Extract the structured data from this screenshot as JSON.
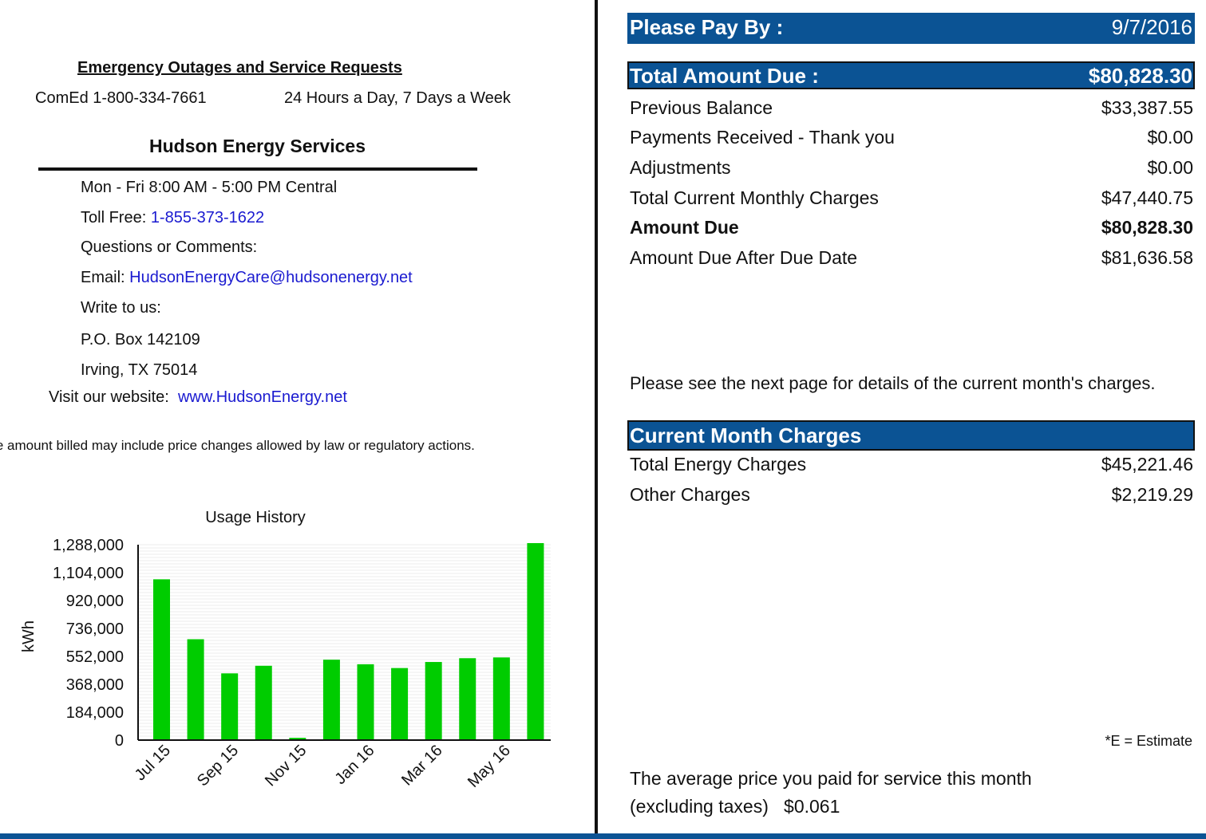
{
  "emergency": {
    "title": "Emergency Outages and Service Requests",
    "utility_phone": "ComEd  1-800-334-7661",
    "hours": "24 Hours a Day, 7 Days a Week"
  },
  "hudson": {
    "title": "Hudson Energy Services",
    "hours": "Mon - Fri 8:00 AM - 5:00 PM Central",
    "toll_free_label": "Toll Free:",
    "toll_free_number": "1-855-373-1622",
    "questions": "Questions or Comments:",
    "email_label": "Email:",
    "email": "HudsonEnergyCare@hudsonenergy.net",
    "write_label": "Write to us:",
    "po_box": "P.O. Box 142109",
    "city": "Irving, TX 75014",
    "website_label": "Visit our website:",
    "website": "www.HudsonEnergy.net"
  },
  "disclaimer": "The amount billed may include price changes allowed by law or regulatory actions.",
  "chart_data": {
    "type": "bar",
    "title": "Usage History",
    "ylabel": "kWh",
    "xlabel": "",
    "ylim": [
      0,
      1288000
    ],
    "yticks": [
      "0",
      "184,000",
      "368,000",
      "552,000",
      "736,000",
      "920,000",
      "1,104,000",
      "1,288,000"
    ],
    "ytick_values": [
      0,
      184000,
      368000,
      552000,
      736000,
      920000,
      1104000,
      1288000
    ],
    "categories": [
      "Jul 15",
      "Aug 15",
      "Sep 15",
      "Oct 15",
      "Nov 15",
      "Dec 15",
      "Jan 16",
      "Feb 16",
      "Mar 16",
      "Apr 16",
      "May 16",
      "Jun 16"
    ],
    "xtick_labels": [
      "Jul 15",
      "Sep 15",
      "Nov 15",
      "Jan 16",
      "Mar 16",
      "May 16"
    ],
    "values": [
      1060000,
      665000,
      440000,
      490000,
      15000,
      530000,
      500000,
      475000,
      515000,
      540000,
      545000,
      1300000
    ],
    "grid": true,
    "bar_color": "#00cc00"
  },
  "payment": {
    "pay_by_label": "Please Pay By :",
    "pay_by_date": "9/7/2016",
    "total_due_label": "Total Amount Due :",
    "total_due_value": "$80,828.30",
    "rows": [
      {
        "label": "Previous Balance",
        "value": "$33,387.55"
      },
      {
        "label": "Payments Received - Thank you",
        "value": "$0.00"
      },
      {
        "label": "Adjustments",
        "value": "$0.00"
      },
      {
        "label": "Total Current Monthly Charges",
        "value": "$47,440.75"
      },
      {
        "label": "Amount Due",
        "value": "$80,828.30"
      },
      {
        "label": "Amount Due After Due Date",
        "value": "$81,636.58"
      }
    ],
    "see_next_page": "Please see the next page for details of the current month's charges."
  },
  "current_month": {
    "title": "Current Month Charges",
    "rows": [
      {
        "label": "Total Energy Charges",
        "value": "$45,221.46"
      },
      {
        "label": "Other Charges",
        "value": "$2,219.29"
      }
    ]
  },
  "estimate_note": "*E = Estimate",
  "average_price": {
    "line1": "The average price you paid for service  this month",
    "line2_label": "(excluding taxes)",
    "line2_value": "$0.061"
  },
  "colors": {
    "header_blue": "#0b5394",
    "link_blue": "#1a1ad0",
    "bar_green": "#00cc00"
  }
}
